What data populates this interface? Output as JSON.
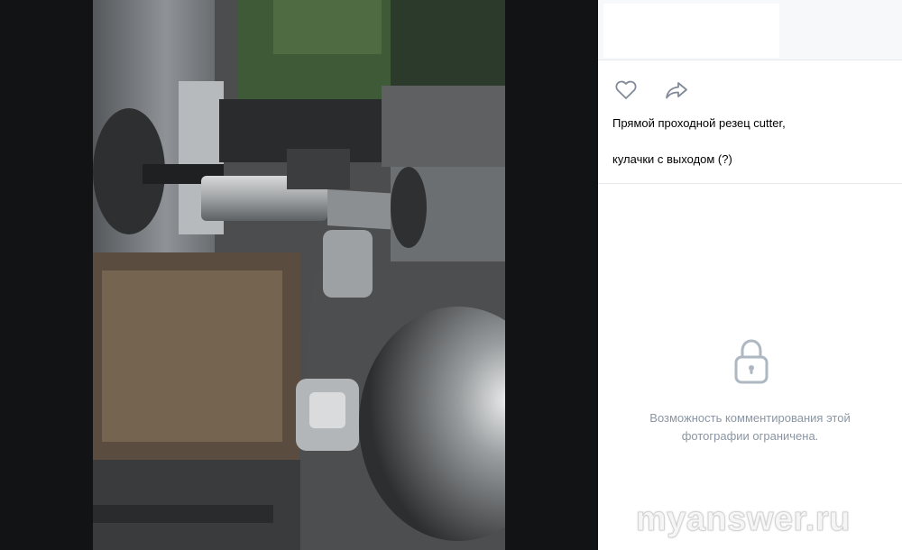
{
  "photo": {
    "subject": "lathe-with-cutting-tool",
    "colors": {
      "machine_green": "#3f5a36",
      "steel": "#8a8d8f",
      "dark_steel": "#3a3c3e",
      "chips": "#7a6a55"
    }
  },
  "sidebar": {
    "actions": [
      {
        "icon": "heart-icon",
        "name": "like-button"
      },
      {
        "icon": "share-icon",
        "name": "share-button"
      }
    ],
    "caption_line1": "Прямой проходной резец cutter,",
    "caption_line2": "кулачки с выходом (?)",
    "comments_closed": {
      "icon": "lock-icon",
      "line1": "Возможность комментирования этой",
      "line2": "фотографии ограничена."
    },
    "colors": {
      "icon": "#828a99",
      "muted_text": "#8b96a3",
      "border": "#e7e8ec"
    }
  },
  "watermark": "myanswer.ru"
}
